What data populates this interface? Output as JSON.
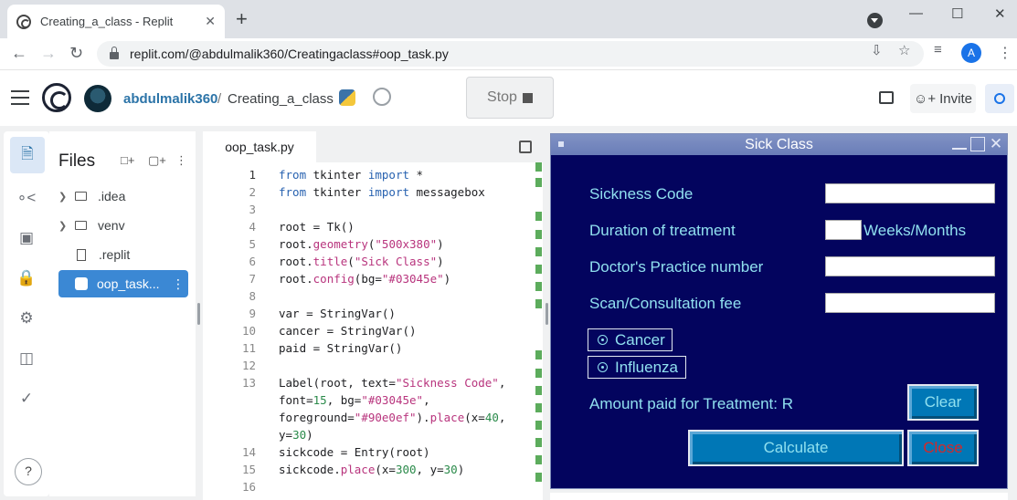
{
  "browser": {
    "tab_title": "Creating_a_class - Replit",
    "tab_close": "✕",
    "new_tab": "+",
    "url": "replit.com/@abdulmalik360/Creatingaclass#oop_task.py",
    "profile_initial": "A",
    "window_controls": [
      "—",
      "☐",
      "✕"
    ]
  },
  "replit": {
    "username": "abdulmalik360",
    "separator": "/",
    "repl_name": "Creating_a_class",
    "stop_label": "Stop",
    "invite_label": "Invite"
  },
  "files": {
    "title": "Files",
    "items": [
      {
        "name": ".idea",
        "type": "folder"
      },
      {
        "name": "venv",
        "type": "folder"
      },
      {
        "name": ".replit",
        "type": "file"
      },
      {
        "name": "oop_task...",
        "type": "python",
        "active": true
      }
    ]
  },
  "editor": {
    "tab_label": "oop_task.py",
    "line_numbers": [
      "1",
      "2",
      "3",
      "4",
      "5",
      "6",
      "7",
      "8",
      "9",
      "10",
      "11",
      "12",
      "13",
      "",
      "",
      "",
      "14",
      "15",
      "16"
    ]
  },
  "tk_window": {
    "title": "Sick Class",
    "bg_color": "#03045e",
    "fg_color": "#90e0ef",
    "labels": {
      "sickness_code": "Sickness Code",
      "duration": "Duration of treatment",
      "weeks_months": "Weeks/Months",
      "practice_number": "Doctor's Practice number",
      "fee": "Scan/Consultation fee",
      "amount_paid": "Amount paid for Treatment: R"
    },
    "radio_options": [
      "Cancer",
      "Influenza"
    ],
    "buttons": {
      "clear": "Clear",
      "calculate": "Calculate",
      "close": "Close"
    }
  }
}
